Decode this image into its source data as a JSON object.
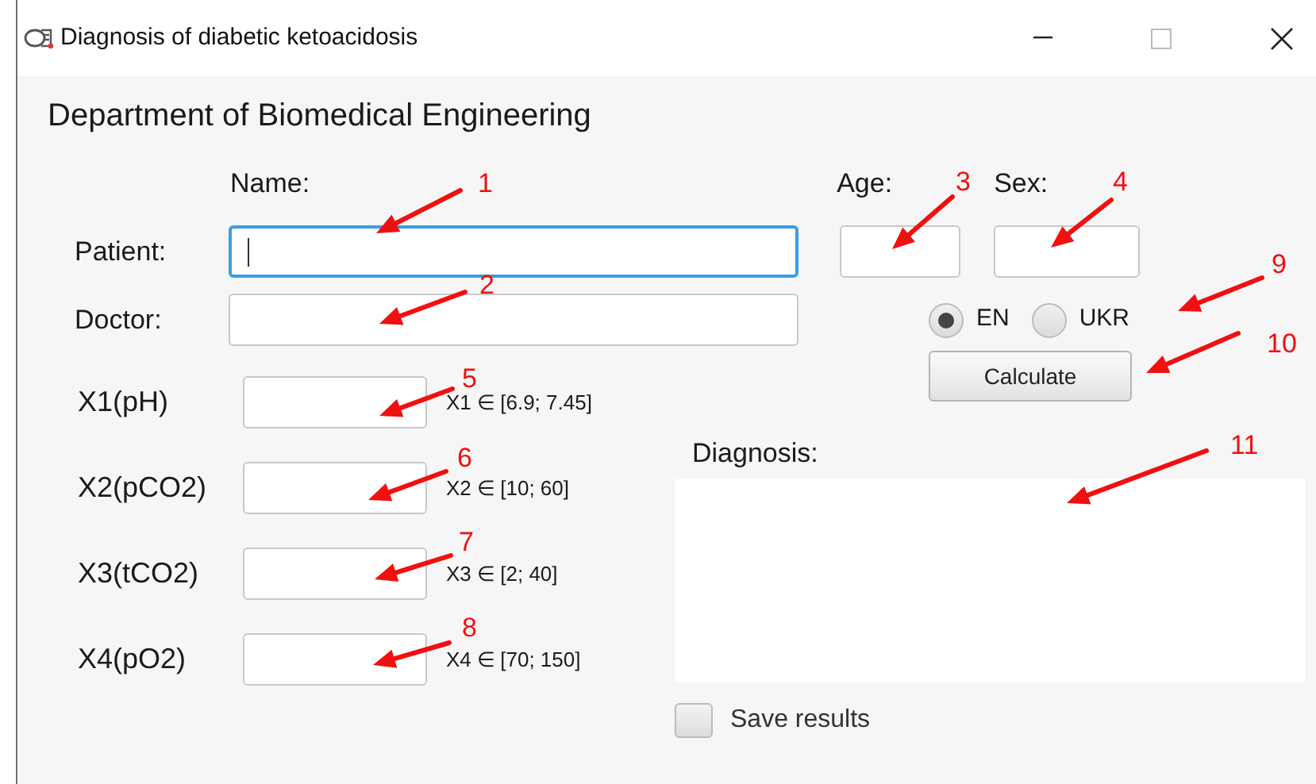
{
  "window": {
    "title": "Diagnosis of diabetic ketoacidosis"
  },
  "heading": "Department of Biomedical Engineering",
  "column_labels": {
    "name": "Name:",
    "age": "Age:",
    "sex": "Sex:"
  },
  "people": [
    {
      "label": "Patient:",
      "focused": true
    },
    {
      "label": "Doctor:",
      "focused": false
    }
  ],
  "age_field": {
    "focused": false
  },
  "sex_field": {
    "focused": false
  },
  "languages": [
    {
      "label": "EN",
      "selected": true
    },
    {
      "label": "UKR",
      "selected": false
    }
  ],
  "calculate_button": "Calculate",
  "parameters": [
    {
      "label": "X1(pH)",
      "range": "X1 ∈ [6.9; 7.45]"
    },
    {
      "label": "X2(pCO2)",
      "range": "X2 ∈ [10; 60]"
    },
    {
      "label": "X3(tCO2)",
      "range": "X3 ∈ [2; 40]"
    },
    {
      "label": "X4(pO2)",
      "range": "X4 ∈ [70; 150]"
    }
  ],
  "diagnosis": {
    "label": "Diagnosis:"
  },
  "save_results": {
    "label": "Save results",
    "checked": false
  },
  "annotations": [
    {
      "number": "1"
    },
    {
      "number": "2"
    },
    {
      "number": "3"
    },
    {
      "number": "4"
    },
    {
      "number": "5"
    },
    {
      "number": "6"
    },
    {
      "number": "7"
    },
    {
      "number": "8"
    },
    {
      "number": "9"
    },
    {
      "number": "10"
    },
    {
      "number": "11"
    }
  ]
}
